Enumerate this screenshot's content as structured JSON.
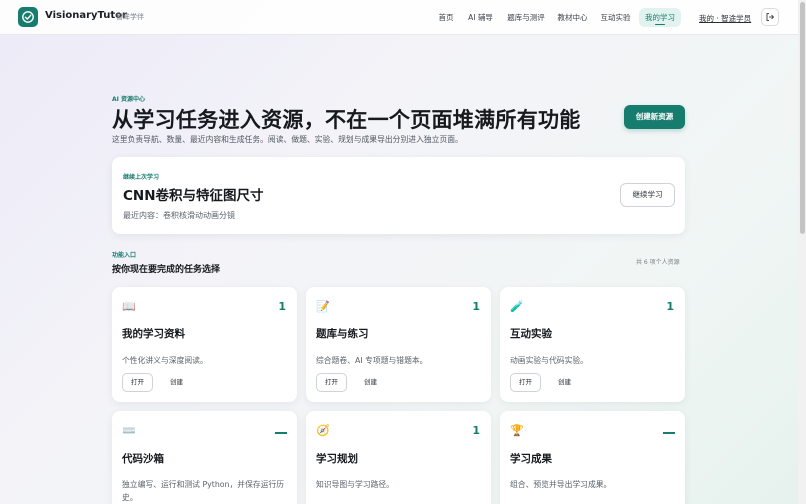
{
  "header": {
    "brand": "VisionaryTutor",
    "brand_sub": "智眸学伴",
    "nav": [
      {
        "label": "首页",
        "active": false
      },
      {
        "label": "AI 辅导",
        "active": false
      },
      {
        "label": "题库与测评",
        "active": false
      },
      {
        "label": "教材中心",
        "active": false
      },
      {
        "label": "互动实验",
        "active": false
      },
      {
        "label": "我的学习",
        "active": true
      }
    ],
    "user_link": "我的 · 智途学员",
    "logout_icon": "logout-icon"
  },
  "hero": {
    "eyebrow": "AI 资源中心",
    "title": "从学习任务进入资源，不在一个页面堆满所有功能",
    "description": "这里负责导航、数量、最近内容和生成任务。阅读、做题、实验、规划与成果导出分别进入独立页面。",
    "create_label": "创建新资源"
  },
  "continue": {
    "label": "继续上次学习",
    "title": "CNN卷积与特征图尺寸",
    "recent": "最近内容：卷积核滑动动画分镜",
    "button": "继续学习"
  },
  "section": {
    "eyebrow": "功能入口",
    "title": "按你现在要完成的任务选择",
    "count": "共 6 项个人资源"
  },
  "cards": [
    {
      "icon": "book-icon",
      "glyph": "📖",
      "count": "1",
      "title": "我的学习资料",
      "desc": "个性化讲义与深度阅读。",
      "open": "打开",
      "create": "创建"
    },
    {
      "icon": "memo-icon",
      "glyph": "📝",
      "count": "1",
      "title": "题库与练习",
      "desc": "综合题卷、AI 专项题与错题本。",
      "open": "打开",
      "create": "创建"
    },
    {
      "icon": "test-tube-icon",
      "glyph": "🧪",
      "count": "1",
      "title": "互动实验",
      "desc": "动画实验与代码实验。",
      "open": "打开",
      "create": "创建"
    },
    {
      "icon": "keyboard-icon",
      "glyph": "⌨️",
      "count": "",
      "title": "代码沙箱",
      "desc": "独立编写、运行和测试 Python，并保存运行历史。"
    },
    {
      "icon": "compass-icon",
      "glyph": "🧭",
      "count": "1",
      "title": "学习规划",
      "desc": "知识导图与学习路径。"
    },
    {
      "icon": "trophy-icon",
      "glyph": "🏆",
      "count": "",
      "title": "学习成果",
      "desc": "组合、预览并导出学习成果。"
    }
  ],
  "colors": {
    "accent": "#167d6e",
    "active_bg": "#e2f2ee"
  }
}
